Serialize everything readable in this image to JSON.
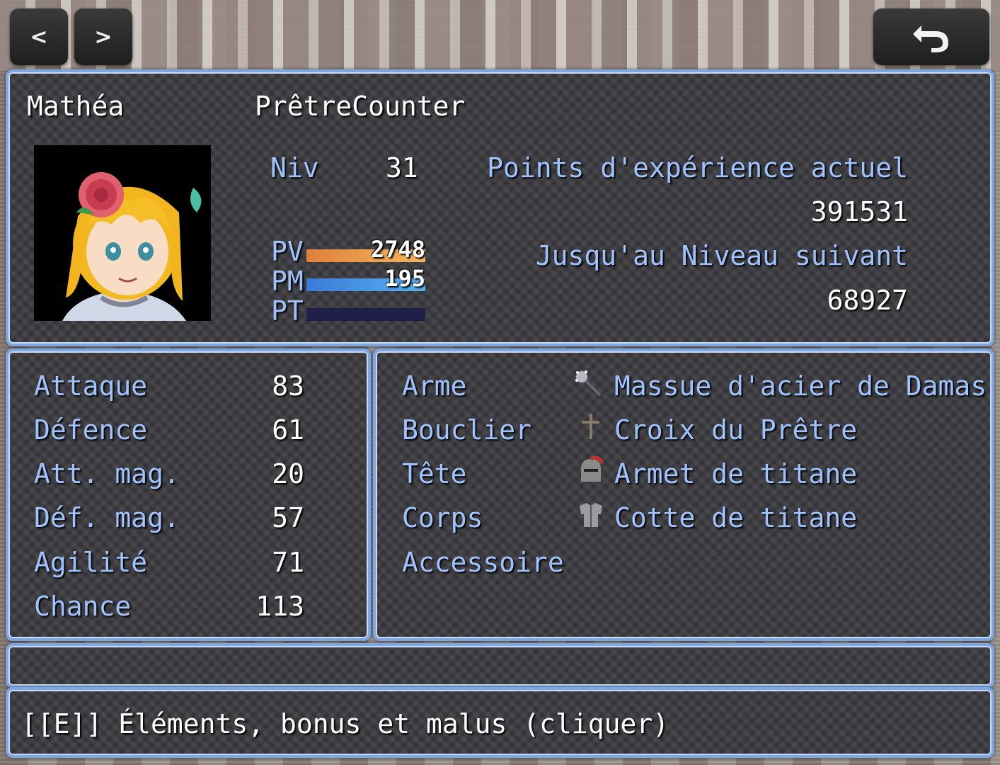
{
  "nav": {
    "prev_label": "<",
    "next_label": ">",
    "back_icon": "undo-arrow-icon"
  },
  "actor": {
    "name": "Mathéa",
    "class": "PrêtreCounter",
    "level_label": "Niv",
    "level": "31",
    "exp_label": "Points d'expérience actuel",
    "exp_value": "391531",
    "next_label": "Jusqu'au Niveau suivant",
    "next_value": "68927",
    "gauges": [
      {
        "label": "PV",
        "value": "2748",
        "fill": 1.0,
        "colors": [
          "#e0803a",
          "#f4b860"
        ]
      },
      {
        "label": "PM",
        "value": "195",
        "fill": 1.0,
        "colors": [
          "#3a7ad8",
          "#5ab0f0"
        ]
      },
      {
        "label": "PT",
        "value": "",
        "fill": 0.0,
        "colors": [
          "#3a7a3a",
          "#6ad06a"
        ]
      }
    ]
  },
  "params": [
    {
      "label": "Attaque",
      "value": "83"
    },
    {
      "label": "Défence",
      "value": "61"
    },
    {
      "label": "Att. mag.",
      "value": "20"
    },
    {
      "label": "Déf. mag.",
      "value": "57"
    },
    {
      "label": "Agilité",
      "value": "71"
    },
    {
      "label": "Chance",
      "value": "113"
    }
  ],
  "equip": [
    {
      "slot": "Arme",
      "item": "Massue d'acier de Damas",
      "icon": "mace-icon"
    },
    {
      "slot": "Bouclier",
      "item": "Croix du Prêtre",
      "icon": "cross-icon"
    },
    {
      "slot": "Tête",
      "item": "Armet de titane",
      "icon": "helmet-icon"
    },
    {
      "slot": "Corps",
      "item": "Cotte de titane",
      "icon": "armor-icon"
    },
    {
      "slot": "Accessoire",
      "item": "",
      "icon": ""
    }
  ],
  "help_text": "[[E]] Éléments, bonus et malus  (cliquer)",
  "colors": {
    "window_border": "#7ea6e0",
    "system_blue": "#9fc3ff",
    "window_bg": "#3b3b3f"
  }
}
